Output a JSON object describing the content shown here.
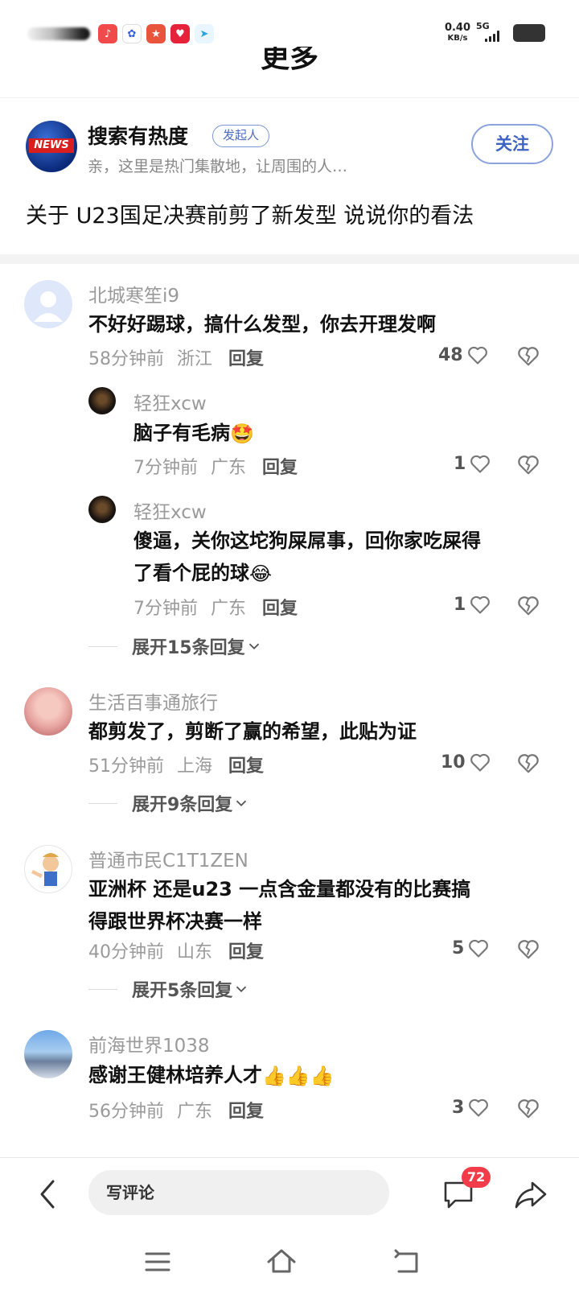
{
  "status_bar": {
    "net_speed": "0.40",
    "net_unit": "KB/s",
    "signal_label": "5G"
  },
  "top_partial_title": "更多",
  "topic": {
    "avatar_text": "NEWS",
    "title": "搜索有热度",
    "badge": "发起人",
    "description": "亲，这里是热门集散地，让周围的人…",
    "follow_label": "关注",
    "question": "关于 U23国足决赛前剪了新发型 说说你的看法"
  },
  "comments": [
    {
      "username": "北城寒笙i9",
      "text": "不好好踢球，搞什么发型，你去开理发啊",
      "time": "58分钟前",
      "location": "浙江",
      "reply_label": "回复",
      "likes": "48",
      "replies": [
        {
          "username": "轻狂xcw",
          "text": "脑子有毛病",
          "emoji": "🤩",
          "time": "7分钟前",
          "location": "广东",
          "reply_label": "回复",
          "likes": "1"
        },
        {
          "username": "轻狂xcw",
          "text_line1": "傻逼，关你这坨狗屎屌事，回你家吃屎得",
          "text_line2": "了看个屁的球",
          "emoji": "😂",
          "time": "7分钟前",
          "location": "广东",
          "reply_label": "回复",
          "likes": "1"
        }
      ],
      "expand_label": "展开15条回复"
    },
    {
      "username": "生活百事通旅行",
      "text": "都剪发了，剪断了赢的希望，此贴为证",
      "time": "51分钟前",
      "location": "上海",
      "reply_label": "回复",
      "likes": "10",
      "expand_label": "展开9条回复"
    },
    {
      "username": "普通市民C1T1ZEN",
      "text_line1": "亚洲杯 还是u23  一点含金量都没有的比赛搞",
      "text_line2": "得跟世界杯决赛一样",
      "time": "40分钟前",
      "location": "山东",
      "reply_label": "回复",
      "likes": "5",
      "expand_label": "展开5条回复"
    },
    {
      "username": "前海世界1038",
      "text": "感谢王健林培养人才",
      "emoji": "👍👍👍",
      "time": "56分钟前",
      "location": "广东",
      "reply_label": "回复",
      "likes": "3"
    }
  ],
  "bottom_bar": {
    "input_placeholder": "写评论",
    "comment_count": "72"
  },
  "colors": {
    "accent_blue": "#3d63c2",
    "badge_red": "#f23c4a",
    "meta_gray": "#9a9a9a"
  }
}
